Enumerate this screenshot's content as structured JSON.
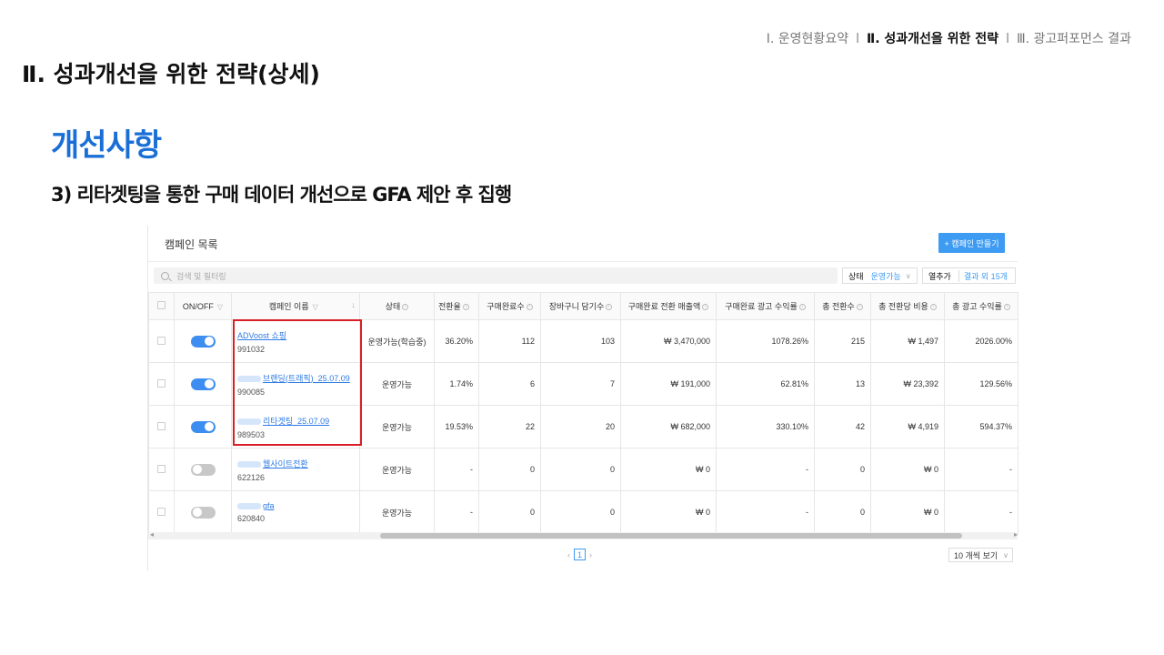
{
  "nav": {
    "item1": "Ⅰ. 운영현황요약",
    "sep": "l",
    "item2": "Ⅱ. 성과개선을 위한 전략",
    "item3": "Ⅲ. 광고퍼포먼스 결과"
  },
  "page_title": "Ⅱ. 성과개선을 위한 전략(상세)",
  "section_title": "개선사항",
  "sub_title": "3) 리타겟팅을 통한 구매 데이터 개선으로 GFA 제안 후 집행",
  "panel": {
    "title": "캠페인 목록",
    "create_button": "+ 캠페인 만들기",
    "search_placeholder": "검색 및 필터링",
    "status_label": "상태",
    "status_value": "운영가능",
    "columns_label": "열추가",
    "columns_value": "결과 외 15개",
    "columns": [
      "ON/OFF",
      "캠페인 이름",
      "상태",
      "전환율",
      "구매완료수",
      "장바구니 담기수",
      "구매완료 전환 매출액",
      "구매완료 광고 수익률",
      "총 전환수",
      "총 전환당 비용",
      "총 광고 수익률"
    ],
    "rows": [
      {
        "on": true,
        "name": "ADVoost 쇼핑",
        "id": "991032",
        "status": "운영가능(학습중)",
        "cvr": "36.20%",
        "purchases": "112",
        "cart": "103",
        "revenue": "₩ 3,470,000",
        "roas": "1078.26%",
        "total_conv": "215",
        "cpa": "₩ 1,497",
        "total_roas": "2026.00%"
      },
      {
        "on": true,
        "name": "브랜딩(트래픽)_25.07.09",
        "id": "990085",
        "status": "운영가능",
        "cvr": "1.74%",
        "purchases": "6",
        "cart": "7",
        "revenue": "₩ 191,000",
        "roas": "62.81%",
        "total_conv": "13",
        "cpa": "₩ 23,392",
        "total_roas": "129.56%"
      },
      {
        "on": true,
        "name": "리타겟팅_25.07.09",
        "id": "989503",
        "status": "운영가능",
        "cvr": "19.53%",
        "purchases": "22",
        "cart": "20",
        "revenue": "₩ 682,000",
        "roas": "330.10%",
        "total_conv": "42",
        "cpa": "₩ 4,919",
        "total_roas": "594.37%"
      },
      {
        "on": false,
        "name": "웹사이트전환",
        "id": "622126",
        "status": "운영가능",
        "cvr": "-",
        "purchases": "0",
        "cart": "0",
        "revenue": "₩ 0",
        "roas": "-",
        "total_conv": "0",
        "cpa": "₩ 0",
        "total_roas": "-"
      },
      {
        "on": false,
        "name": "gfa",
        "id": "620840",
        "status": "운영가능",
        "cvr": "-",
        "purchases": "0",
        "cart": "0",
        "revenue": "₩ 0",
        "roas": "-",
        "total_conv": "0",
        "cpa": "₩ 0",
        "total_roas": "-"
      }
    ],
    "page": "1",
    "per_page": "10 개씩 보기"
  }
}
